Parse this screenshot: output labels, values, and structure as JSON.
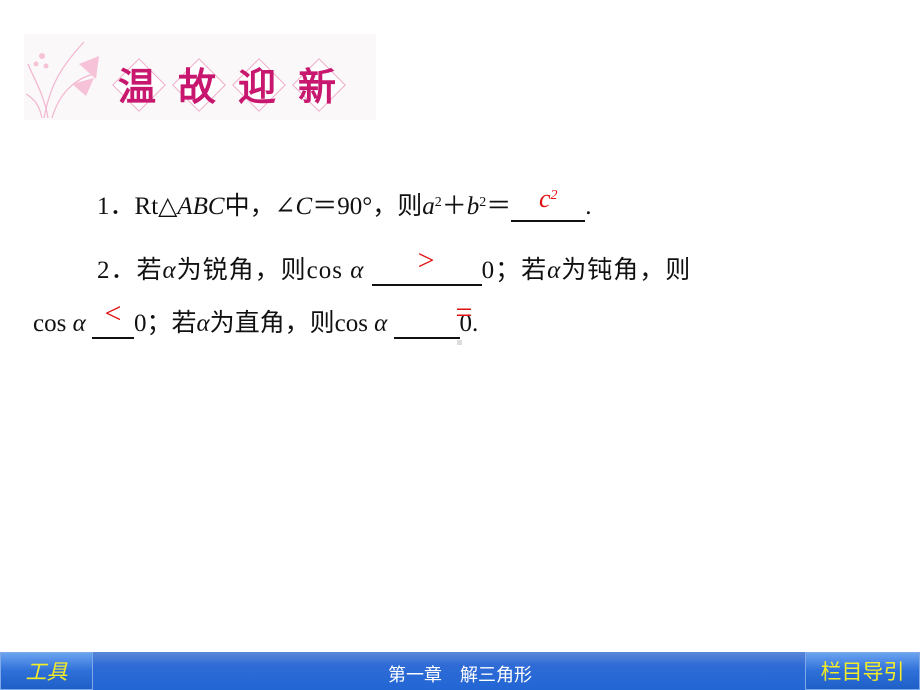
{
  "banner": {
    "title_chars": [
      "温",
      "故",
      "迎",
      "新"
    ],
    "icon": "butterfly-orchid-decoration"
  },
  "questions": [
    {
      "number": "1．",
      "parts": [
        "Rt△",
        "ABC",
        "中，∠",
        "C",
        "＝90°，则",
        "a",
        "b",
        "＋",
        "＝"
      ],
      "answer": "c",
      "answer_sup": "2",
      "end": "."
    },
    {
      "number": "2．",
      "line1": {
        "t1": "若",
        "alpha": "α",
        "t2": "为锐角，则cos ",
        "ans": ">",
        "t3": "0；若",
        "t4": "为钝角，则"
      },
      "line2": {
        "t1": "cos ",
        "ans1": "<",
        "t2": "0；若",
        "t3": "为直角，则cos ",
        "ans2": "=",
        "t4": "0."
      }
    }
  ],
  "footer": {
    "left_button": "工具",
    "title": "第一章　解三角形",
    "right_button": "栏目导引"
  },
  "colors": {
    "answer": "#e01010",
    "banner_text": "#c8176e",
    "footer_bg": "#2266d4",
    "footer_button_text": "#f4ec26"
  }
}
